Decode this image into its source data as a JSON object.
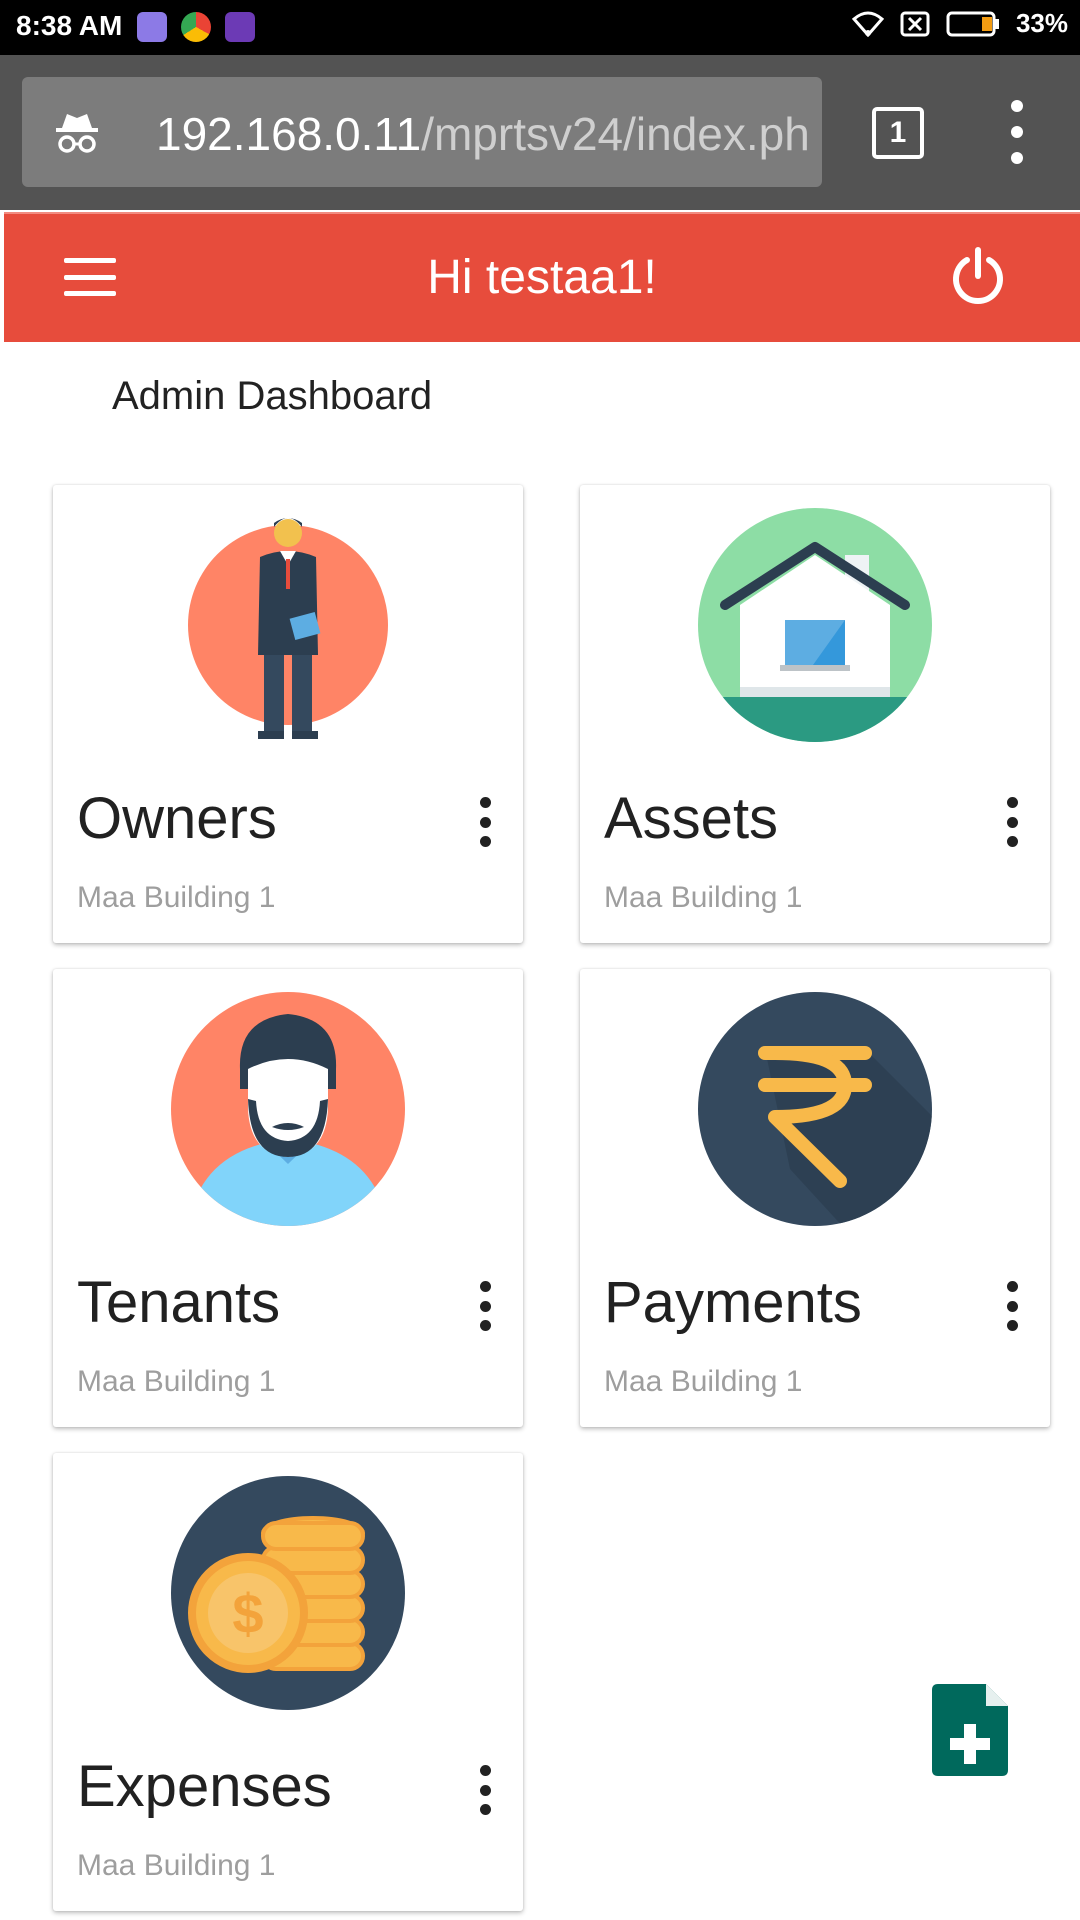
{
  "status_bar": {
    "time": "8:38 AM",
    "battery": "33%"
  },
  "browser": {
    "url_host": "192.168.0.11",
    "url_path": "/mprtsv24/index.ph",
    "tab_count": "1"
  },
  "appbar": {
    "greeting": "Hi testaa1!"
  },
  "page": {
    "title": "Admin Dashboard"
  },
  "cards": [
    {
      "title": "Owners",
      "subtitle": "Maa Building 1",
      "icon": "businessman-icon"
    },
    {
      "title": "Assets",
      "subtitle": "Maa Building 1",
      "icon": "house-icon"
    },
    {
      "title": "Tenants",
      "subtitle": "Maa Building 1",
      "icon": "bearded-man-icon"
    },
    {
      "title": "Payments",
      "subtitle": "Maa Building 1",
      "icon": "rupee-icon"
    },
    {
      "title": "Expenses",
      "subtitle": "Maa Building 1",
      "icon": "coins-icon"
    }
  ],
  "colors": {
    "appbar": "#e74c3c",
    "fab": "#00695c"
  }
}
